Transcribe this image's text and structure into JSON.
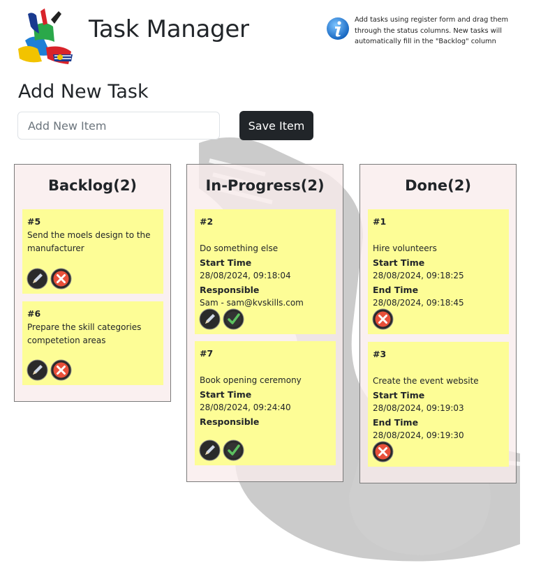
{
  "header": {
    "title": "Task Manager",
    "info_text": "Add tasks using register form and drag them through the status columns. New tasks will automatically fill in the \"Backlog\" column",
    "logo_text": "KVSKILLS"
  },
  "form": {
    "heading": "Add New Task",
    "input_placeholder": "Add New Item",
    "input_value": "",
    "save_label": "Save Item"
  },
  "columns": [
    {
      "title": "Backlog(2)",
      "cards": [
        {
          "id": "#5",
          "desc": "Send the moels design to the manufacturer",
          "actions": [
            "edit-icon",
            "delete-icon"
          ]
        },
        {
          "id": "#6",
          "desc": "Prepare the skill categories competetion areas",
          "actions": [
            "edit-icon",
            "delete-icon"
          ]
        }
      ]
    },
    {
      "title": "In-Progress(2)",
      "cards": [
        {
          "id": "#2",
          "desc": "Do something else",
          "start_label": "Start Time",
          "start_time": "28/08/2024, 09:18:04",
          "resp_label": "Responsible",
          "resp_value": "Sam - sam@kvskills.com",
          "actions": [
            "edit-icon",
            "check-icon"
          ]
        },
        {
          "id": "#7",
          "desc": "Book opening ceremony",
          "start_label": "Start Time",
          "start_time": "28/08/2024, 09:24:40",
          "resp_label": "Responsible",
          "resp_value": "",
          "actions": [
            "edit-icon",
            "check-icon"
          ]
        }
      ]
    },
    {
      "title": "Done(2)",
      "cards": [
        {
          "id": "#1",
          "desc": "Hire volunteers",
          "start_label": "Start Time",
          "start_time": "28/08/2024, 09:18:25",
          "end_label": "End Time",
          "end_time": "28/08/2024, 09:18:45",
          "actions": [
            "delete-icon"
          ]
        },
        {
          "id": "#3",
          "desc": "Create the event website",
          "start_label": "Start Time",
          "start_time": "28/08/2024, 09:19:03",
          "end_label": "End Time",
          "end_time": "28/08/2024, 09:19:30",
          "actions": [
            "delete-icon"
          ]
        }
      ]
    }
  ],
  "colors": {
    "card": "#fdfd96",
    "column_bg": "#f8ecec",
    "button_dark": "#212529",
    "delete_red": "#e8503a",
    "check_green": "#4caf50",
    "info_blue": "#2f8fd8"
  }
}
